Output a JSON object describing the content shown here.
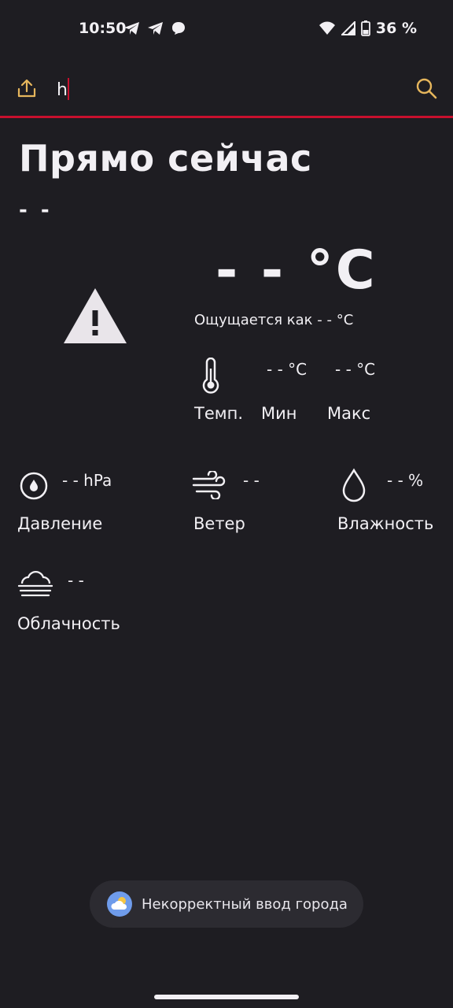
{
  "status_bar": {
    "time": "10:50",
    "battery": "36 %"
  },
  "search": {
    "value": "h"
  },
  "main": {
    "title": "Прямо сейчас",
    "subtitle": "- -",
    "temperature": "- - °C",
    "feels_like": "Ощущается как - - °C",
    "min_value": "- - °C",
    "max_value": "- - °C",
    "temp_label": "Темп.",
    "min_label": "Мин",
    "max_label": "Макс"
  },
  "details": {
    "pressure": {
      "value": "- - hPa",
      "label": "Давление"
    },
    "wind": {
      "value": "- -",
      "label": "Ветер"
    },
    "humidity": {
      "value": "- - %",
      "label": "Влажность"
    },
    "clouds": {
      "value": "- -",
      "label": "Облачность"
    }
  },
  "toast": {
    "text": "Некорректный ввод города"
  },
  "colors": {
    "background": "#1e1d22",
    "accent": "#c8102e",
    "icon_accent": "#e6b65c"
  }
}
